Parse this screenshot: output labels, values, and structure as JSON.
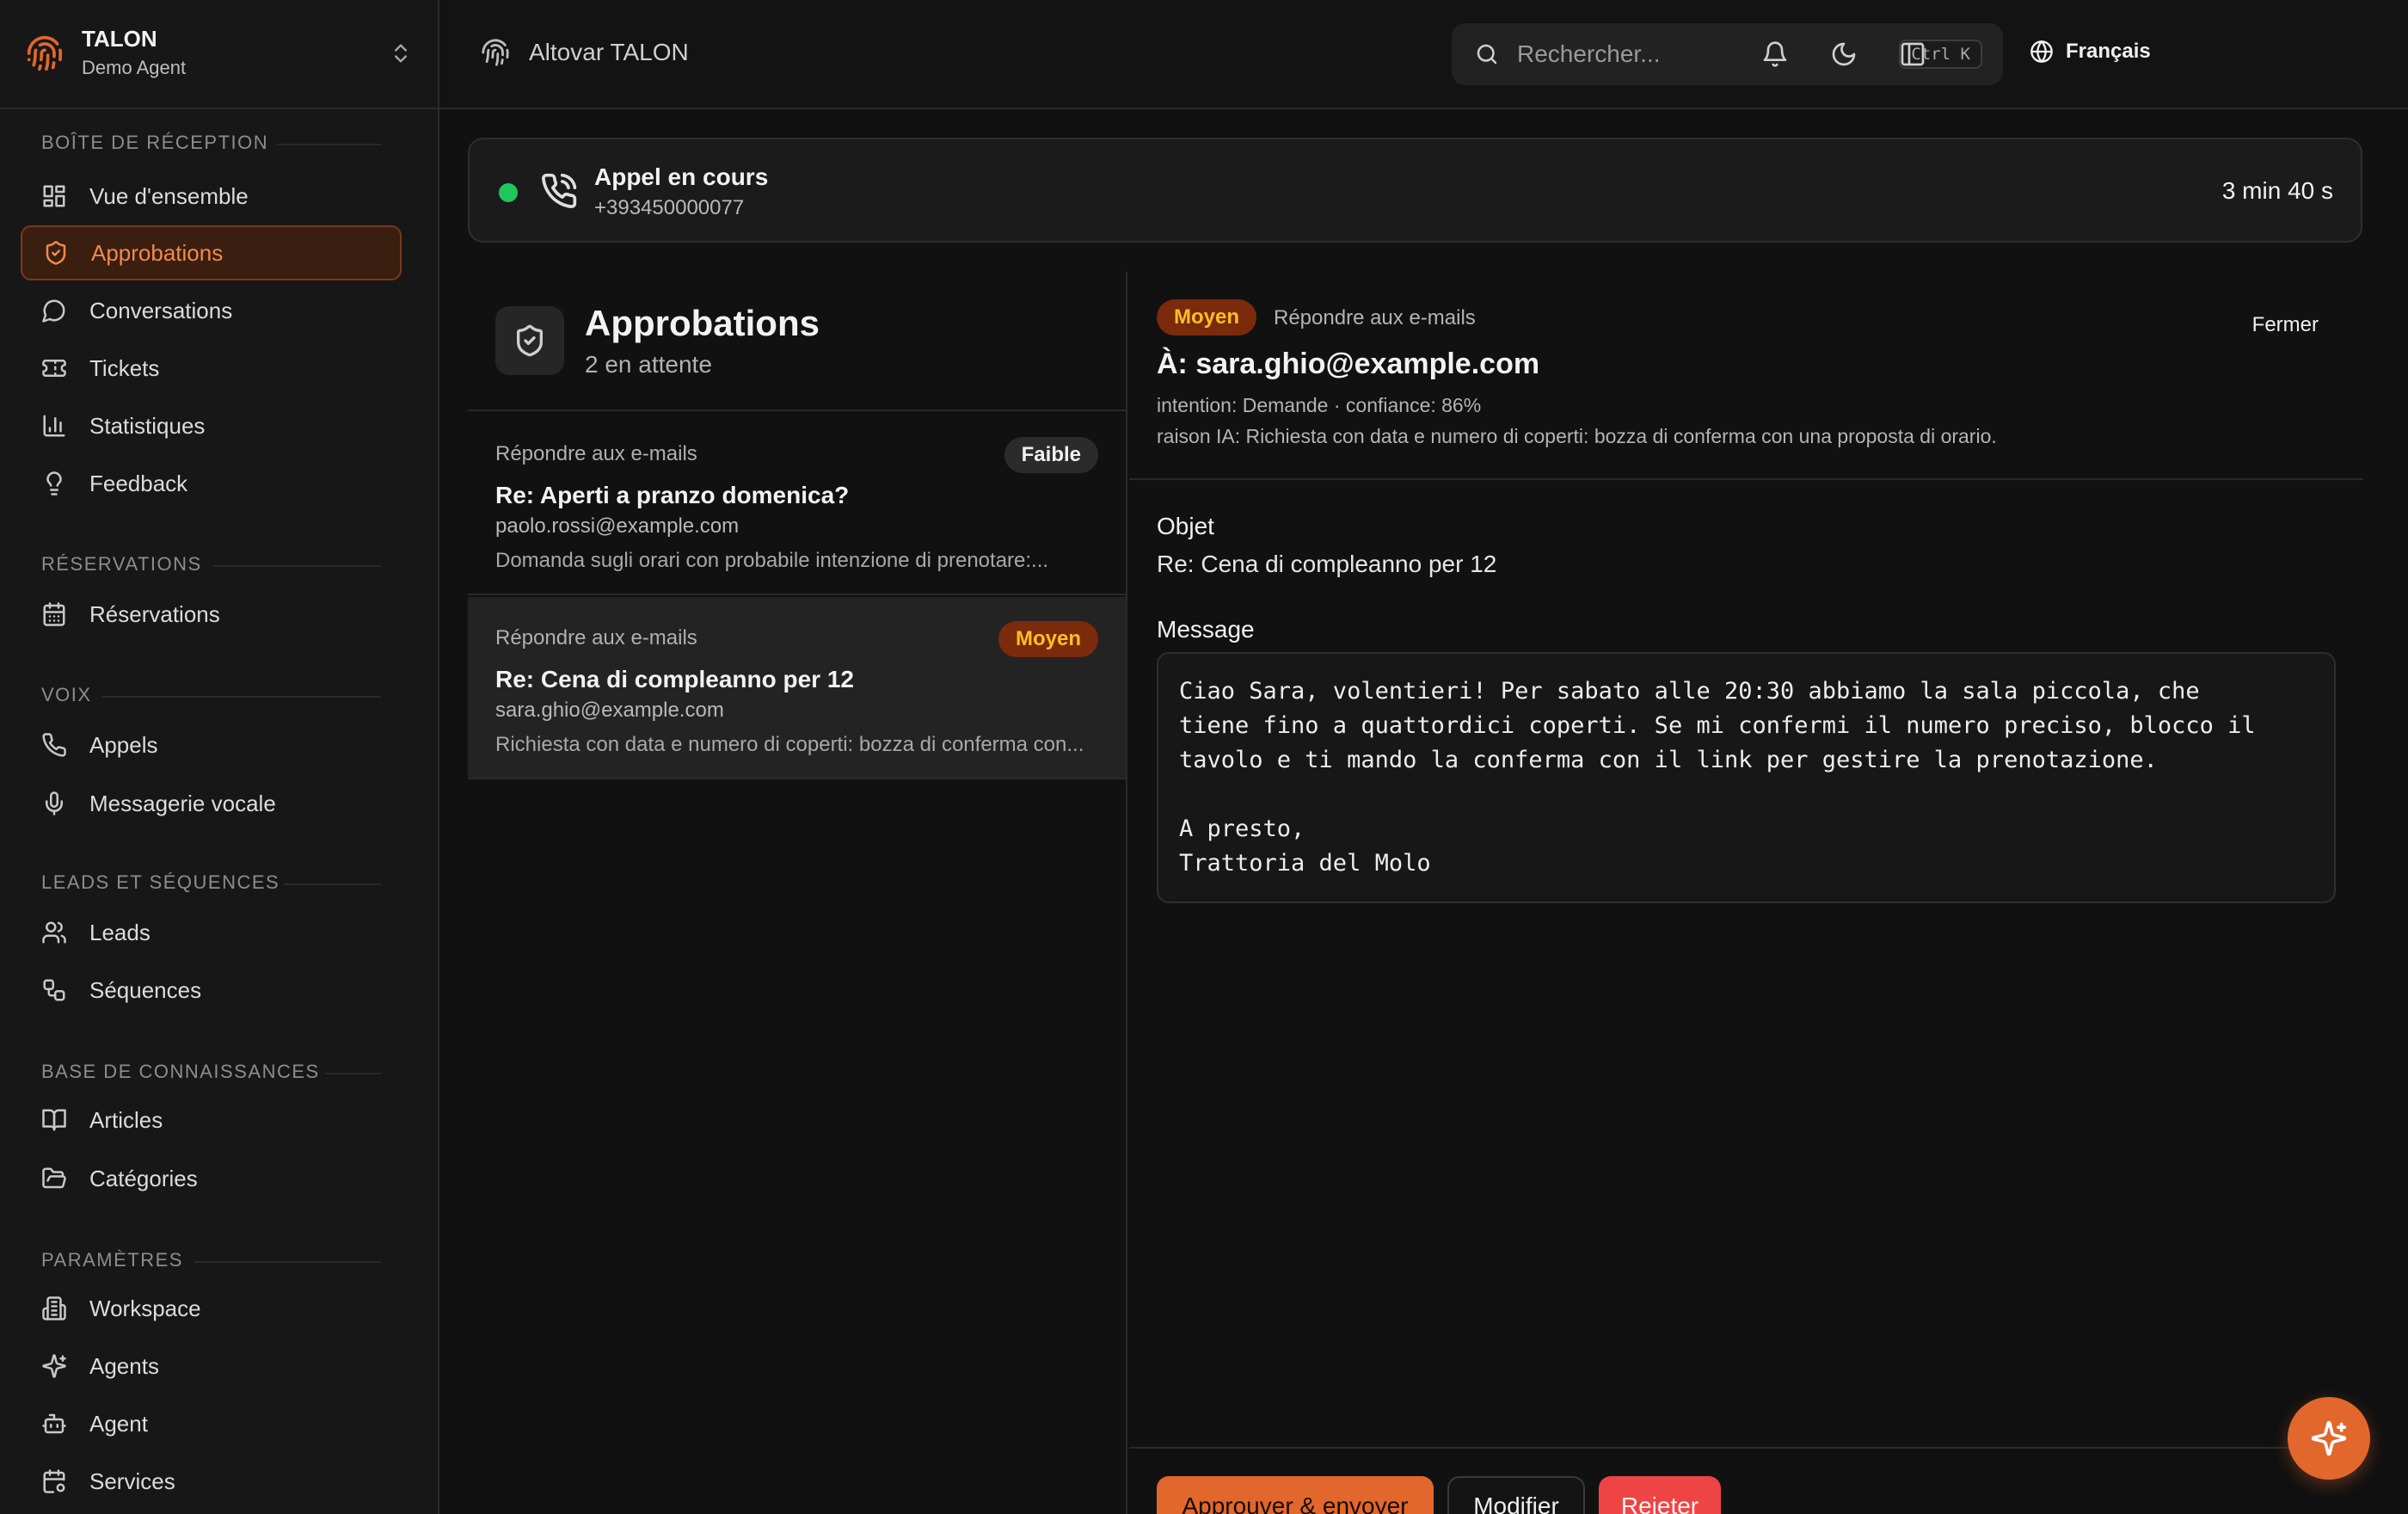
{
  "workspace": {
    "name": "TALON",
    "subtitle": "Demo Agent"
  },
  "sidebar": {
    "groups": [
      {
        "title": "BOÎTE DE RÉCEPTION",
        "items": [
          {
            "label": "Vue d'ensemble",
            "icon": "grid-icon"
          },
          {
            "label": "Approbations",
            "icon": "shield-check-icon",
            "active": true
          },
          {
            "label": "Conversations",
            "icon": "chat-bubble-icon"
          },
          {
            "label": "Tickets",
            "icon": "ticket-icon"
          },
          {
            "label": "Statistiques",
            "icon": "bar-chart-icon"
          },
          {
            "label": "Feedback",
            "icon": "lightbulb-icon"
          }
        ]
      },
      {
        "title": "RÉSERVATIONS",
        "items": [
          {
            "label": "Réservations",
            "icon": "calendar-icon"
          }
        ]
      },
      {
        "title": "VOIX",
        "items": [
          {
            "label": "Appels",
            "icon": "phone-icon"
          },
          {
            "label": "Messagerie vocale",
            "icon": "microphone-icon"
          }
        ]
      },
      {
        "title": "LEADS ET SÉQUENCES",
        "items": [
          {
            "label": "Leads",
            "icon": "users-icon"
          },
          {
            "label": "Séquences",
            "icon": "workflow-icon"
          }
        ]
      },
      {
        "title": "BASE DE CONNAISSANCES",
        "items": [
          {
            "label": "Articles",
            "icon": "book-icon"
          },
          {
            "label": "Catégories",
            "icon": "folder-icon"
          }
        ]
      },
      {
        "title": "PARAMÈTRES",
        "items": [
          {
            "label": "Workspace",
            "icon": "building-icon"
          },
          {
            "label": "Agents",
            "icon": "sparkles-icon"
          },
          {
            "label": "Agent",
            "icon": "bot-icon"
          },
          {
            "label": "Services",
            "icon": "calendar-cog-icon"
          }
        ]
      }
    ]
  },
  "topbar": {
    "breadcrumb": "Altovar TALON",
    "search_placeholder": "Rechercher...",
    "search_shortcut": "Ctrl K",
    "language": "Français"
  },
  "call": {
    "title": "Appel en cours",
    "number": "+393450000077",
    "duration": "3 min 40 s",
    "status_color": "#22c55e"
  },
  "approvals": {
    "title": "Approbations",
    "subtitle": "2 en attente",
    "items": [
      {
        "category": "Répondre aux e-mails",
        "priority": "Faible",
        "subject": "Re: Aperti a pranzo domenica?",
        "from": "paolo.rossi@example.com",
        "preview": "Domanda sugli orari con probabile intenzione di prenotare:..."
      },
      {
        "category": "Répondre aux e-mails",
        "priority": "Moyen",
        "subject": "Re: Cena di compleanno per 12",
        "from": "sara.ghio@example.com",
        "preview": "Richiesta con data e numero di coperti: bozza di conferma con..."
      }
    ]
  },
  "detail": {
    "priority": "Moyen",
    "category": "Répondre aux e-mails",
    "close_label": "Fermer",
    "to": "À: sara.ghio@example.com",
    "meta_intent": "intention: Demande · confiance: 86%",
    "meta_reason": "raison IA: Richiesta con data e numero di coperti: bozza di conferma con una proposta di orario.",
    "subject_label": "Objet",
    "subject_value": "Re: Cena di compleanno per 12",
    "message_label": "Message",
    "message_body": "Ciao Sara, volentieri! Per sabato alle 20:30 abbiamo la sala piccola, che\ntiene fino a quattordici coperti. Se mi confermi il numero preciso, blocco il\ntavolo e ti mando la conferma con il link per gestire la prenotazione.\n\nA presto,\nTrattoria del Molo",
    "approve_label": "Approuver & envoyer",
    "edit_label": "Modifier",
    "reject_label": "Rejeter"
  },
  "colors": {
    "accent": "#e2672c",
    "danger": "#ef4444",
    "warning_text": "#fbbf24"
  }
}
